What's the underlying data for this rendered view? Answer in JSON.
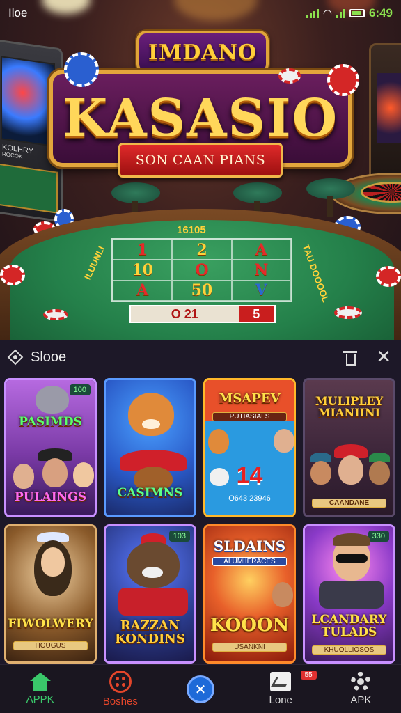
{
  "status_bar": {
    "carrier": "Iloe",
    "time": "6:49"
  },
  "hero": {
    "top_plaque": "IMDANO",
    "main_title": "KASASIO",
    "ribbon": "SON CAAN PIANS",
    "left_machine_label": "KOLHRY",
    "left_machine_sub": "ROCOK",
    "table": {
      "header": "16105",
      "cells": [
        "1",
        "2",
        "A",
        "10",
        "O",
        "N",
        "A",
        "50",
        "V"
      ],
      "left_side": "ILUUNLI",
      "right_side": "TAU DOOOOL",
      "score_left": "O 21",
      "score_right": "5"
    }
  },
  "panel": {
    "title": "Slooe",
    "icons": {
      "title_icon": "diamond-icon",
      "trash": "trash-icon",
      "close": "close-icon"
    },
    "games": [
      {
        "title_top": "PASIMDS",
        "title_bottom": "PULAINGS",
        "badge": "100",
        "theme": "#7a3aa6"
      },
      {
        "title_top": "",
        "title_bottom": "CASIMNS",
        "badge": "",
        "theme": "#2a5ac8"
      },
      {
        "title_top": "MSAPEV",
        "subtitle": "PUTIASIALS",
        "number": "14",
        "caption": "O643 23946",
        "theme": "#2a9ae0"
      },
      {
        "title_top": "MULIPLEY MIANIINI",
        "title_bottom": "CAANDANE",
        "theme": "#4a2a4e"
      },
      {
        "title_top": "",
        "title_bottom": "FIWOLWERY",
        "caption": "HOUGUS",
        "theme": "#5a3a22"
      },
      {
        "title_top": "",
        "title_bottom": "RAZZAN KONDINS",
        "badge": "103",
        "theme": "#2a3a8a"
      },
      {
        "title_top": "SLDAINS",
        "subtitle": "ALUMIIERACES",
        "title_bottom": "KOOON",
        "caption": "USANKNI",
        "theme": "#c8401a"
      },
      {
        "title_top": "",
        "title_bottom": "LCANDARY TULADS",
        "caption": "KHUOLLIOSOS",
        "badge": "330",
        "theme": "#6a2a8a"
      }
    ]
  },
  "nav": {
    "items": [
      {
        "label": "APPK",
        "icon": "home-icon",
        "color": "#3ac86a"
      },
      {
        "label": "Boshes",
        "icon": "bonus-icon",
        "color": "#e2452a"
      },
      {
        "label": "",
        "icon": "center-action-icon",
        "color": "#1e6ad8"
      },
      {
        "label": "Lone",
        "icon": "line-chart-icon",
        "badge": "55"
      },
      {
        "label": "APK",
        "icon": "gear-icon"
      }
    ]
  }
}
